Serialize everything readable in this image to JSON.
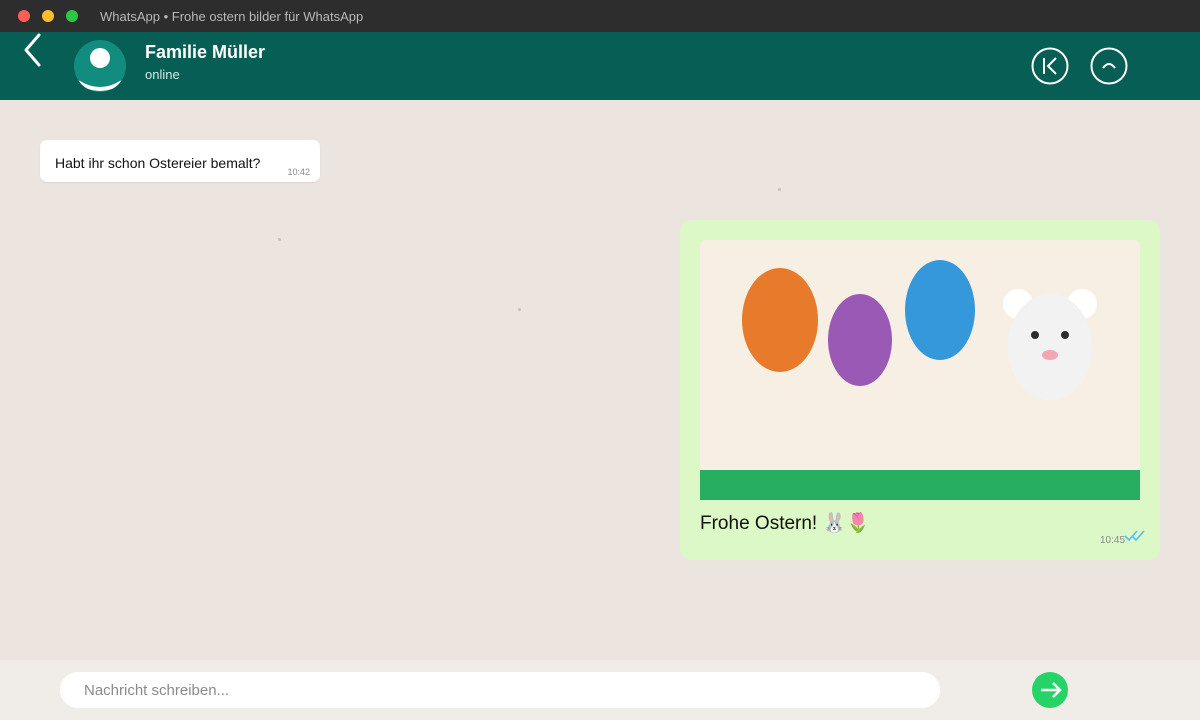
{
  "window": {
    "title": "WhatsApp • Frohe ostern bilder für WhatsApp"
  },
  "header": {
    "contact_name": "Familie Müller",
    "status": "online",
    "back_icon": "chevron-left-icon",
    "actions": [
      "skip-back-icon",
      "collapse-icon"
    ]
  },
  "messages": [
    {
      "direction": "incoming",
      "text": "Habt ihr schon Ostereier bemalt?",
      "time": "10:42"
    },
    {
      "direction": "outgoing",
      "type": "image",
      "caption": "Frohe Ostern! 🐰🌷",
      "time": "10:45",
      "read_receipt": "double-check-icon"
    }
  ],
  "composer": {
    "placeholder": "Nachricht schreiben...",
    "value": "",
    "send_icon": "send-icon"
  },
  "colors": {
    "header": "#075e54",
    "chat_background": "#ece5df",
    "outgoing_bubble": "#dcf8c6",
    "accent": "#25d366",
    "read_tick": "#4fc3f7"
  }
}
